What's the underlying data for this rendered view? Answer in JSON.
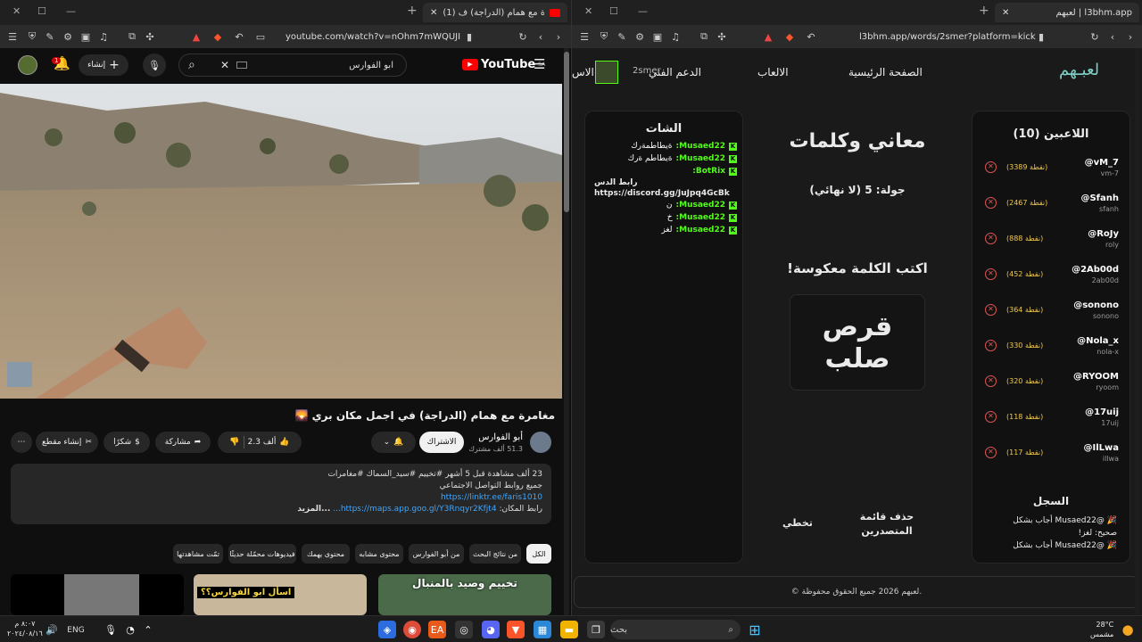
{
  "left_browser": {
    "tab_title": "(1) مغامرة مع همام (الدراجة) ف...",
    "url": "youtube.com/watch?v=nOhm7mWQUJI",
    "new_tab": "+",
    "youtube": {
      "logo_text": "YouTube",
      "logo_region": "SA",
      "search_value": "ابو الفوارس",
      "create_label": "إنشاء",
      "notif_count": "1"
    },
    "video_title": "مغامرة مع همام (الدراجة) في اجمل مكان بري 🌄",
    "channel": {
      "name": "أبو الفوارس",
      "subs": "51.3 ألف مشترك",
      "subscribe_label": "الاشتراك"
    },
    "actions": {
      "likes": "2.3 ألف",
      "share": "مشاركة",
      "thanks": "شكرًا",
      "clip": "إنشاء مقطع"
    },
    "description": {
      "meta": "23 ألف مشاهدة  قبل 5 أشهر  #تخييم #سيد_السماك #مغامرات",
      "line1": "جميع روابط التواصل الاجتماعي",
      "link1": "https://linktr.ee/faris1010",
      "line3_prefix": "رابط المكان: ",
      "link2": "https://maps.app.goo.gl/Y3Rnqyr2Kfjt4...",
      "more": "...المزيد"
    },
    "chips": [
      "الكل",
      "من نتائج البحث",
      "من أبو الفوارس",
      "محتوى مشابه",
      "محتوى يهمك",
      "فيديوهات محمّلة حديثًا",
      "تمّت مشاهدتها"
    ],
    "thumb_texts": [
      "تخييم وصيد بالمنبال",
      "اسأل ابو الفوارس؟؟"
    ]
  },
  "right_browser": {
    "tab_title": "لعبهم | l3bhm.app",
    "url": "l3bhm.app/words/2smer?platform=kick",
    "nav": {
      "logo": "لعبـهم",
      "home": "الصفحة الرئيسية",
      "games": "الالعاب",
      "support": "الدعم الفني",
      "user": "2smer",
      "cut": "الاس"
    },
    "players_title": "اللاعبين (10)",
    "players": [
      {
        "name": "@vM_7",
        "user": "vm-7",
        "points": "(3389 نقطة)"
      },
      {
        "name": "@Sfanh",
        "user": "sfanh",
        "points": "(2467 نقطة)"
      },
      {
        "name": "@RoJy",
        "user": "roly",
        "points": "(888 نقطة)"
      },
      {
        "name": "@2Ab00d",
        "user": "2ab00d",
        "points": "(452 نقطة)"
      },
      {
        "name": "@sonono",
        "user": "sonono",
        "points": "(364 نقطة)"
      },
      {
        "name": "@Nola_x",
        "user": "nola-x",
        "points": "(330 نقطة)"
      },
      {
        "name": "@RYOOM",
        "user": "ryoom",
        "points": "(320 نقطة)"
      },
      {
        "name": "@17uij",
        "user": "17uij",
        "points": "(118 نقطة)"
      },
      {
        "name": "@IlLwa",
        "user": "illwa",
        "points": "(117 نقطة)"
      }
    ],
    "log_title": "السجل",
    "log": [
      "🎉 @Musaed22 أجاب بشكل",
      "صحيح: لغز!",
      "🎉 @Musaed22 أجاب بشكل"
    ],
    "game_title": "معاني وكلمات",
    "round": "جولة: 5 (لا نهائي)",
    "instruction": "اكتب الكلمة معكوسة!",
    "word_line1": "قرص",
    "word_line2": "صلب",
    "skip": "تخطي",
    "delete_leaders": "حذف قائمة المتصدرين",
    "chat_title": "الشات",
    "chat": [
      {
        "user": "Musaed22:",
        "msg": "ةيطاطمةرك"
      },
      {
        "user": "Musaed22:",
        "msg": "ةيطاطم ةرك"
      },
      {
        "user": "BotRix:",
        "msg": ""
      },
      {
        "user": "",
        "msg": "رابط الدس https://discord.gg/JuJpq4GcBk"
      },
      {
        "user": "Musaed22:",
        "msg": "ن"
      },
      {
        "user": "Musaed22:",
        "msg": "خ"
      },
      {
        "user": "Musaed22:",
        "msg": "لغز"
      }
    ],
    "footer": "© لعبهم 2026 جميع الحقوق محفوظة."
  },
  "taskbar": {
    "weather_temp": "28°C",
    "weather_desc": "مشمس",
    "search": "بحث",
    "lang": "ENG",
    "time": "٨:٠٧ م",
    "date": "٢٠٢٤/٠٨/١٦"
  }
}
